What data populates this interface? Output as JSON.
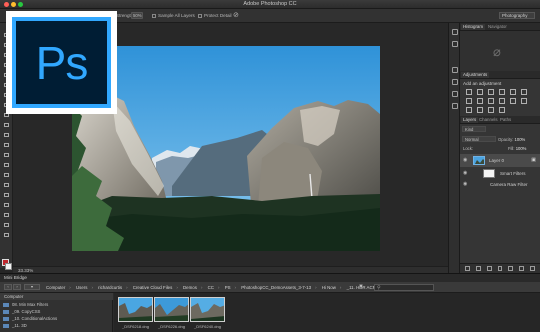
{
  "window": {
    "title": "Adobe Photoshop CC"
  },
  "logo": {
    "text": "Ps"
  },
  "options": {
    "strength_label": "Strength:",
    "strength_value": "50%",
    "sample_all_layers": "Sample All Layers",
    "protect_detail": "Protect Detail",
    "workspace": "Photography"
  },
  "colors": {
    "foreground": "#c0262d",
    "background": "#f2f2f2",
    "accent": "#31a8ff"
  },
  "canvas": {
    "zoom": "33.33%"
  },
  "panels": {
    "top_tabs": [
      "Histogram",
      "Navigator"
    ],
    "adjustments_tab": "Adjustments",
    "adjustments_title": "Add an adjustment",
    "layers_tabs": [
      "Layers",
      "Channels",
      "Paths"
    ],
    "kind_filter": "Kind",
    "blend_mode": "Normal",
    "opacity_label": "Opacity:",
    "opacity_value": "100%",
    "lock_label": "Lock:",
    "fill_label": "Fill:",
    "fill_value": "100%",
    "layers": [
      {
        "name": "Layer 0"
      },
      {
        "name": "Smart Filters"
      },
      {
        "name": "Camera Raw Filter"
      }
    ]
  },
  "bridge": {
    "title": "Mini Bridge",
    "path": [
      "Computer",
      "Users",
      "richardcurtis",
      "Creative Cloud Files",
      "Demos",
      "CC",
      "PS",
      "PhotoshopCC_DemoAssets_3-7-13",
      "Hi Now",
      "_11. HDR ACR"
    ],
    "folders_header": "Computer",
    "folders": [
      "08. Min Max Filters",
      "_09. CopyCSS",
      "_10. ConditionalActions",
      "_11. 3D"
    ],
    "thumbnails": [
      {
        "label": "_DSF6218.dng"
      },
      {
        "label": "_DSF6226.dng"
      },
      {
        "label": "_DSF6240.dng"
      }
    ]
  }
}
